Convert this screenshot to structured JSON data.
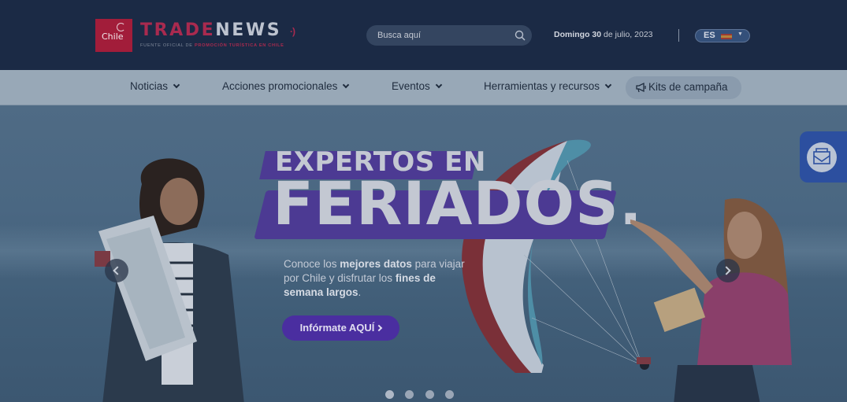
{
  "header": {
    "logo": {
      "text": "Chile"
    },
    "brand": {
      "part1": "TRADE",
      "part2": "NEWS"
    },
    "tagline_prefix": "FUENTE OFICIAL DE",
    "tagline_bold": "PROMOCIÓN TURÍSTICA EN CHILE",
    "search": {
      "placeholder": "Busca aquí",
      "icon": "search-icon"
    },
    "date": {
      "weekday": "Domingo",
      "day": "30",
      "rest": "de julio, 2023"
    },
    "language": {
      "code": "ES",
      "icon": "flag-spain-icon"
    }
  },
  "nav": {
    "items": [
      {
        "label": "Noticias"
      },
      {
        "label": "Acciones promocionales"
      },
      {
        "label": "Eventos"
      },
      {
        "label": "Herramientas y recursos"
      }
    ],
    "kits": {
      "label": "Kits de campaña",
      "icon": "megaphone-icon"
    }
  },
  "hero": {
    "headline_small": "EXPERTOS EN",
    "headline_big": "FERIADOS.",
    "text_1": "Conoce los ",
    "text_bold_1": "mejores datos",
    "text_2": " para viajar por Chile y disfrutar los ",
    "text_bold_2": "fines de semana largos",
    "text_3": ".",
    "cta_label": "Infórmate AQUÍ",
    "slides_count": 4,
    "active_slide": 1
  },
  "side_tab": {
    "icon": "newsletter-envelope-icon"
  },
  "colors": {
    "header_bg": "#1b2a45",
    "nav_bg": "#98a8b7",
    "brand_red": "#a92a4f",
    "cta_purple": "#4a2ea0",
    "side_tab_blue": "#2c4f9f"
  }
}
